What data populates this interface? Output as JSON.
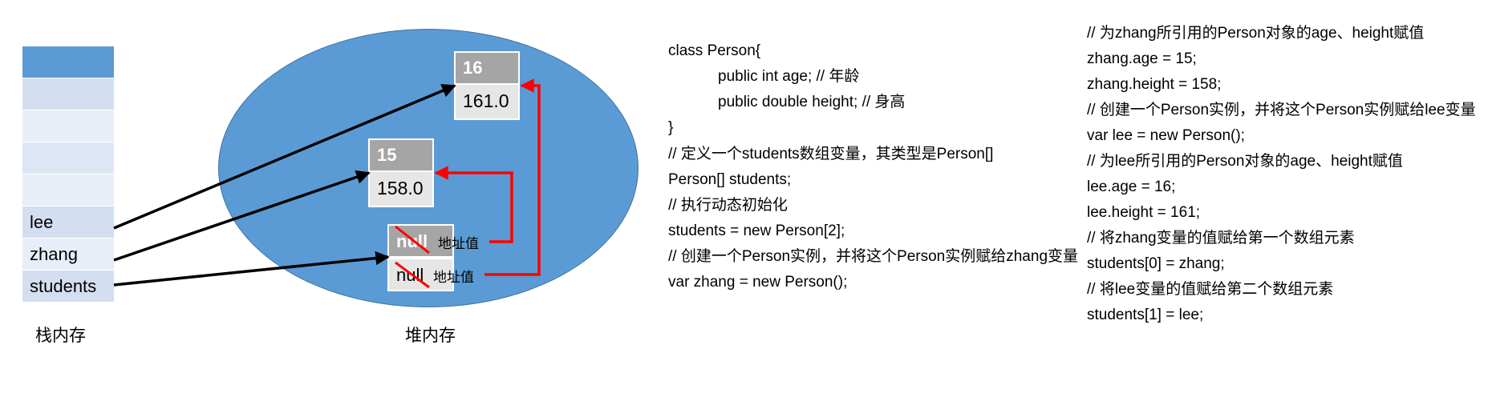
{
  "stack": {
    "cells": [
      "",
      "",
      "",
      "",
      "",
      "lee",
      "zhang",
      "students"
    ],
    "caption": "栈内存"
  },
  "heap": {
    "caption": "堆内存",
    "objects": [
      {
        "age": "16",
        "height": "161.0"
      },
      {
        "age": "15",
        "height": "158.0"
      }
    ],
    "array": {
      "cells": [
        "null",
        "null"
      ],
      "address_labels": [
        "地址值",
        "地址值"
      ]
    }
  },
  "code_left": [
    "class Person{",
    "public int age; // 年龄",
    "public double height; // 身高",
    "}",
    "// 定义一个students数组变量，其类型是Person[]",
    "Person[] students;",
    "// 执行动态初始化",
    "students = new Person[2];",
    "// 创建一个Person实例，并将这个Person实例赋给zhang变量",
    "var zhang = new Person();"
  ],
  "code_right": [
    "// 为zhang所引用的Person对象的age、height赋值",
    "zhang.age = 15;",
    "zhang.height = 158;",
    "// 创建一个Person实例，并将这个Person实例赋给lee变量",
    "var lee = new Person();",
    "// 为lee所引用的Person对象的age、height赋值",
    "lee.age = 16;",
    "lee.height = 161;",
    "// 将zhang变量的值赋给第一个数组元素",
    "students[0] = zhang;",
    "// 将lee变量的值赋给第二个数组元素",
    "students[1] = lee;"
  ],
  "colors": {
    "heap_fill": "#5b9bd5",
    "stack_dark": "#5b9bd5",
    "stack_light": "#d3dff0",
    "object_header": "#a5a5a5",
    "object_body": "#e6e6e6",
    "reference_arrow": "#000000",
    "array_arrow": "#ff0000"
  }
}
